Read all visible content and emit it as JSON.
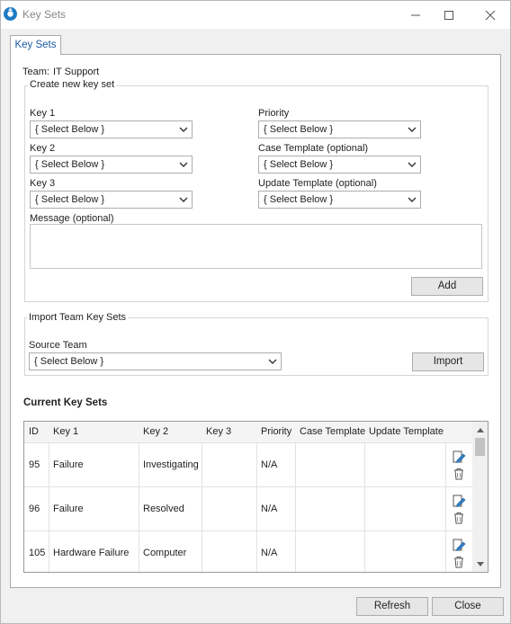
{
  "window": {
    "title": "Key Sets"
  },
  "tab": {
    "label": "Key Sets"
  },
  "team": {
    "label": "Team:",
    "value": "IT Support"
  },
  "create_group": {
    "title": "Create new key set",
    "key1": {
      "label": "Key 1",
      "value": "{ Select Below }"
    },
    "key2": {
      "label": "Key 2",
      "value": "{ Select Below }"
    },
    "key3": {
      "label": "Key 3",
      "value": "{ Select Below }"
    },
    "priority": {
      "label": "Priority",
      "value": "{ Select Below }"
    },
    "case_template": {
      "label": "Case Template (optional)",
      "value": "{ Select Below }"
    },
    "update_template": {
      "label": "Update Template (optional)",
      "value": "{ Select Below }"
    },
    "message": {
      "label": "Message (optional)",
      "value": ""
    },
    "add_label": "Add"
  },
  "import_group": {
    "title": "Import Team Key Sets",
    "source_label": "Source Team",
    "source_value": "{ Select Below }",
    "import_label": "Import"
  },
  "current": {
    "title": "Current Key Sets",
    "columns": [
      "ID",
      "Key 1",
      "Key 2",
      "Key 3",
      "Priority",
      "Case Template",
      "Update Template"
    ],
    "rows": [
      {
        "id": "95",
        "key1": "Failure",
        "key2": "Investigating",
        "key3": "",
        "priority": "N/A",
        "case_template": "",
        "update_template": ""
      },
      {
        "id": "96",
        "key1": "Failure",
        "key2": "Resolved",
        "key3": "",
        "priority": "N/A",
        "case_template": "",
        "update_template": ""
      },
      {
        "id": "105",
        "key1": "Hardware Failure",
        "key2": "Computer",
        "key3": "",
        "priority": "N/A",
        "case_template": "",
        "update_template": ""
      }
    ]
  },
  "footer": {
    "refresh_label": "Refresh",
    "close_label": "Close"
  },
  "icons": {
    "app": "app-logo-icon",
    "row_edit": "edit-pencil-icon",
    "row_delete": "trash-icon",
    "combo": "chevron-down-icon"
  },
  "colors": {
    "tab_text": "#1a5aa6",
    "accent": "#1e7bc4"
  }
}
